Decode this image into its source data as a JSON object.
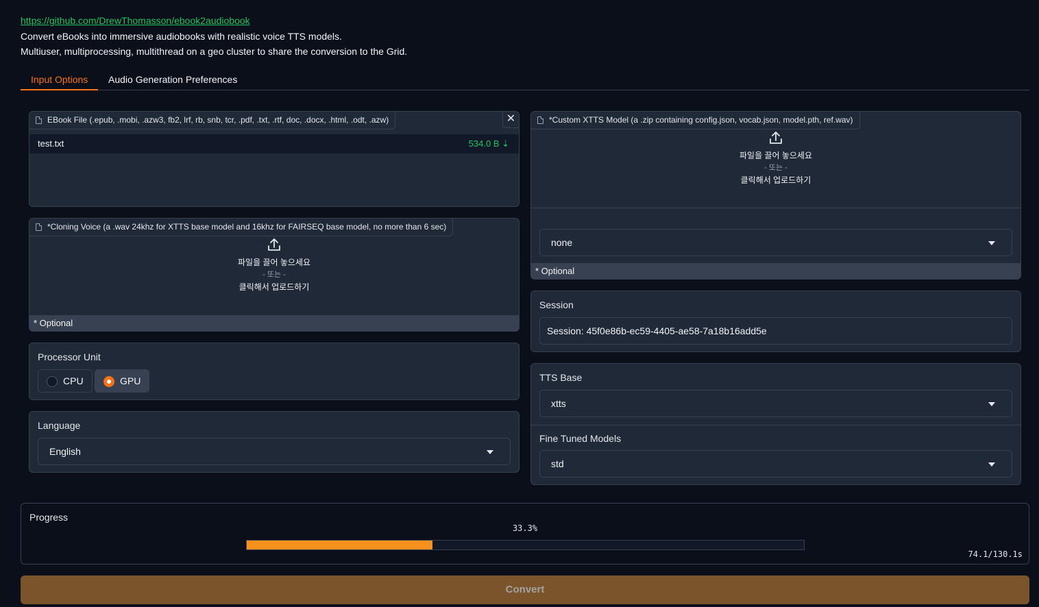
{
  "header": {
    "repo_link": "https://github.com/DrewThomasson/ebook2audiobook",
    "line1": "Convert eBooks into immersive audiobooks with realistic voice TTS models.",
    "line2": "Multiuser, multiprocessing, multithread on a geo cluster to share the conversion to the Grid."
  },
  "tabs": [
    {
      "label": "Input Options",
      "active": true
    },
    {
      "label": "Audio Generation Preferences",
      "active": false
    }
  ],
  "ebook": {
    "label": "EBook File (.epub, .mobi, .azw3, fb2, lrf, rb, snb, tcr, .pdf, .txt, .rtf, doc, .docx, .html, .odt, .azw)",
    "file_name": "test.txt",
    "file_size": "534.0 B ⇣",
    "close": "✕"
  },
  "cloning_voice": {
    "label": "*Cloning Voice (a .wav 24khz for XTTS base model and 16khz for FAIRSEQ base model, no more than 6 sec)",
    "drop_text": "파일을 끌어 놓으세요",
    "or_text": "- 또는 -",
    "click_text": "클릭해서 업로드하기",
    "optional": "* Optional"
  },
  "custom_model": {
    "label": "*Custom XTTS Model (a .zip containing config.json, vocab.json, model.pth, ref.wav)",
    "drop_text": "파일을 끌어 놓으세요",
    "or_text": "- 또는 -",
    "click_text": "클릭해서 업로드하기",
    "select_value": "none",
    "optional": "* Optional"
  },
  "processor": {
    "label": "Processor Unit",
    "options": [
      "CPU",
      "GPU"
    ],
    "selected": "GPU"
  },
  "language": {
    "label": "Language",
    "value": "English"
  },
  "session": {
    "label": "Session",
    "value": "Session: 45f0e86b-ec59-4405-ae58-7a18b16add5e"
  },
  "tts_base": {
    "label": "TTS Base",
    "value": "xtts"
  },
  "fine_tuned": {
    "label": "Fine Tuned Models",
    "value": "std"
  },
  "progress": {
    "label": "Progress",
    "percent_text": "33.3%",
    "fraction": 0.333,
    "time_text": "74.1/130.1s"
  },
  "convert_button": "Convert",
  "colors": {
    "accent": "#f97316",
    "link": "#22c55e",
    "panel": "#1f2937",
    "background": "#0b0f19",
    "progress_fill": "#f7911e",
    "convert_bg": "#7a542a"
  }
}
